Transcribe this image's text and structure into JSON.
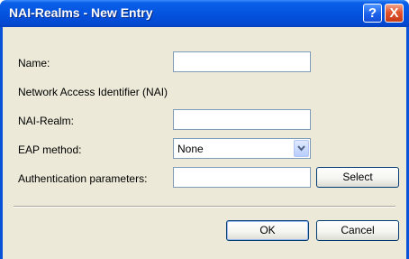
{
  "window": {
    "title": "NAI-Realms - New Entry",
    "help_icon": "?",
    "close_icon": "X"
  },
  "form": {
    "name_label": "Name:",
    "name_value": "",
    "nai_section_label": "Network Access Identifier (NAI)",
    "nai_realm_label": "NAI-Realm:",
    "nai_realm_value": "",
    "eap_method_label": "EAP method:",
    "eap_method_value": "None",
    "auth_params_label": "Authentication parameters:",
    "auth_params_value": "",
    "select_button": "Select"
  },
  "footer": {
    "ok_button": "OK",
    "cancel_button": "Cancel"
  },
  "colors": {
    "titlebar": "#0454e0",
    "client_bg": "#ece9d8",
    "input_border": "#7f9db9"
  }
}
